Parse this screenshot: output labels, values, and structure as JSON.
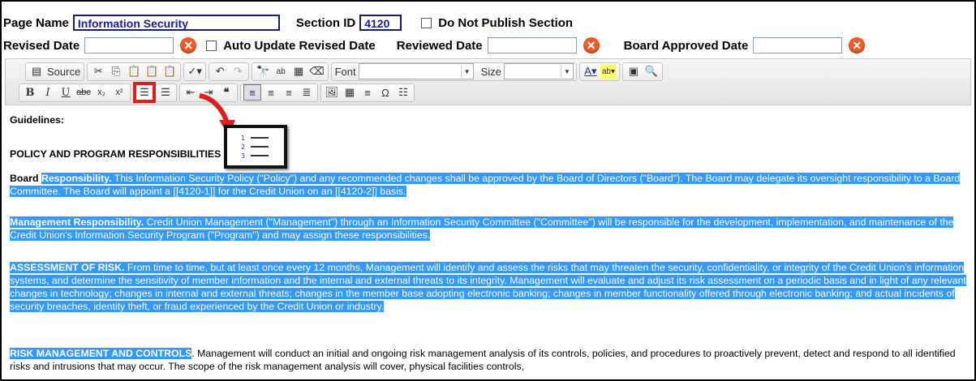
{
  "header": {
    "page_name_label": "Page Name",
    "page_name_value": "Information Security",
    "section_id_label": "Section ID",
    "section_id_value": "4120",
    "do_not_publish_label": "Do Not Publish Section",
    "revised_date_label": "Revised Date",
    "auto_update_label": "Auto Update Revised Date",
    "reviewed_date_label": "Reviewed Date",
    "board_approved_label": "Board Approved Date"
  },
  "toolbar": {
    "source_label": "Source",
    "font_label": "Font",
    "size_label": "Size",
    "bold": "B",
    "italic": "I",
    "underline": "U",
    "strike": "abc",
    "subscript": "x₂",
    "superscript": "x²",
    "highlighted_button": "numbered-list"
  },
  "content": {
    "guidelines": "Guidelines:",
    "policy_heading": "POLICY AND PROGRAM RESPONSIBILITIES",
    "p1_lead": "Board",
    "p1_title": "Responsibility.",
    "p1_text": "This Information Security Policy (\"Policy\") and any recommended changes shall be approved by the Board of Directors (\"Board\"). The Board may delegate its oversight responsibility to a Board Committee. The Board will appoint a [[4120-1]] for the Credit Union on an [[4120-2]] basis.",
    "p2_title": "Management Responsibility.",
    "p2_text": "Credit Union Management (\"Management\") through an Information Security Committee (\"Committee\") will be responsible for the development, implementation, and maintenance of the Credit Union's Information Security Program (\"Program\") and may assign these responsibilities.",
    "p3_title": "ASSESSMENT OF RISK.",
    "p3_text": "From time to time, but at least once every 12 months, Management will identify and assess the risks that may threaten the security, confidentiality, or integrity of the Credit Union's information systems, and determine the sensitivity of member information and the internal and external threats to its integrity. Management will evaluate and adjust its risk assessment on a periodic basis and in light of any relevant changes in technology; changes in internal and external threats; changes in the member base adopting electronic banking; changes in member functionality offered through electronic banking; and actual incidents of security breaches, identity theft, or fraud experienced by the Credit Union or industry.",
    "p4_title": "RISK MANAGEMENT AND CONTROLS",
    "p4_text": ". Management will conduct an initial and ongoing risk management analysis of its controls, policies, and procedures to proactively prevent, detect and respond to all identified risks and intrusions that may occur. The scope of the risk management analysis will cover, physical facilities controls,"
  },
  "colors": {
    "selection": "#3399ff",
    "annotation_red": "#e01c1c",
    "clear_button": "#f05a28"
  }
}
